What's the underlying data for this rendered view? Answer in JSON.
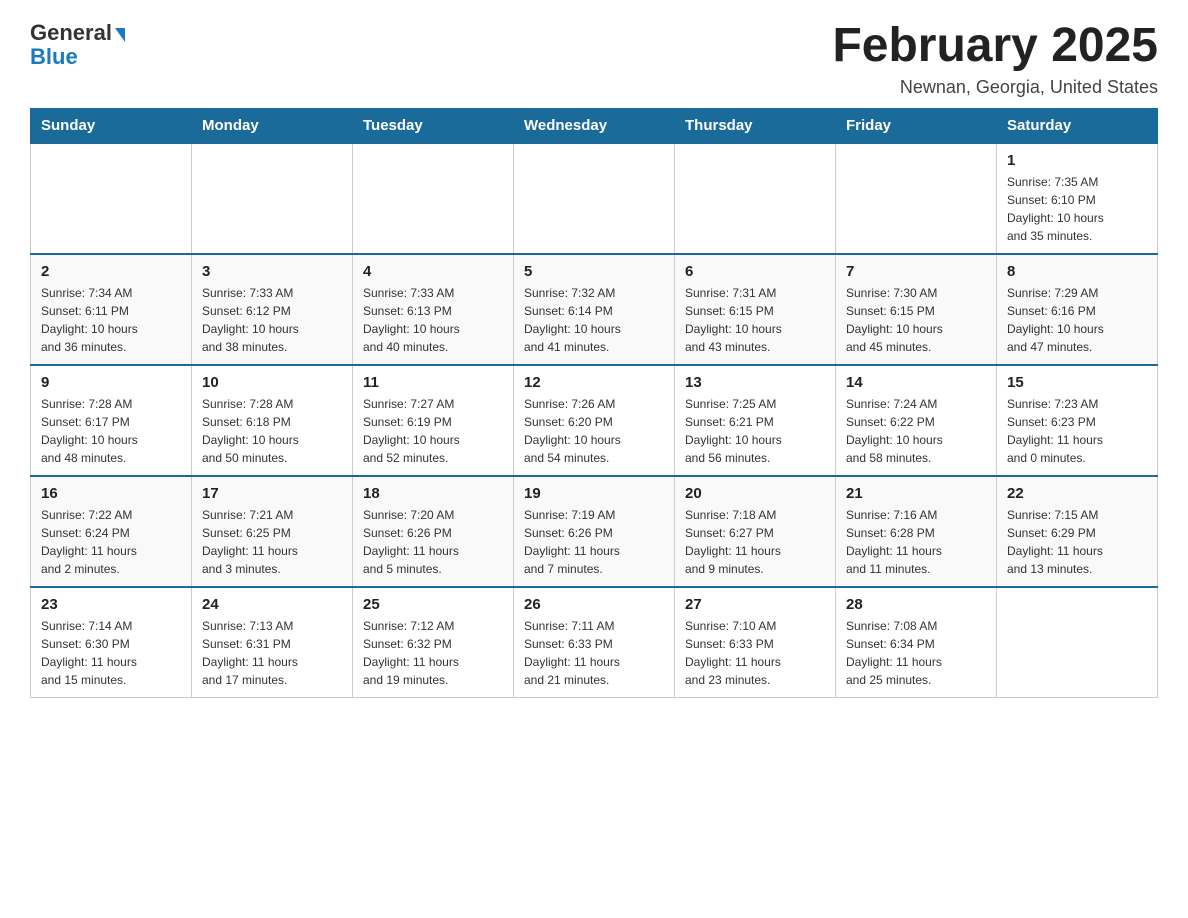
{
  "logo": {
    "general": "General",
    "blue": "Blue"
  },
  "header": {
    "title": "February 2025",
    "location": "Newnan, Georgia, United States"
  },
  "weekdays": [
    "Sunday",
    "Monday",
    "Tuesday",
    "Wednesday",
    "Thursday",
    "Friday",
    "Saturday"
  ],
  "weeks": [
    [
      {
        "day": "",
        "info": ""
      },
      {
        "day": "",
        "info": ""
      },
      {
        "day": "",
        "info": ""
      },
      {
        "day": "",
        "info": ""
      },
      {
        "day": "",
        "info": ""
      },
      {
        "day": "",
        "info": ""
      },
      {
        "day": "1",
        "info": "Sunrise: 7:35 AM\nSunset: 6:10 PM\nDaylight: 10 hours\nand 35 minutes."
      }
    ],
    [
      {
        "day": "2",
        "info": "Sunrise: 7:34 AM\nSunset: 6:11 PM\nDaylight: 10 hours\nand 36 minutes."
      },
      {
        "day": "3",
        "info": "Sunrise: 7:33 AM\nSunset: 6:12 PM\nDaylight: 10 hours\nand 38 minutes."
      },
      {
        "day": "4",
        "info": "Sunrise: 7:33 AM\nSunset: 6:13 PM\nDaylight: 10 hours\nand 40 minutes."
      },
      {
        "day": "5",
        "info": "Sunrise: 7:32 AM\nSunset: 6:14 PM\nDaylight: 10 hours\nand 41 minutes."
      },
      {
        "day": "6",
        "info": "Sunrise: 7:31 AM\nSunset: 6:15 PM\nDaylight: 10 hours\nand 43 minutes."
      },
      {
        "day": "7",
        "info": "Sunrise: 7:30 AM\nSunset: 6:15 PM\nDaylight: 10 hours\nand 45 minutes."
      },
      {
        "day": "8",
        "info": "Sunrise: 7:29 AM\nSunset: 6:16 PM\nDaylight: 10 hours\nand 47 minutes."
      }
    ],
    [
      {
        "day": "9",
        "info": "Sunrise: 7:28 AM\nSunset: 6:17 PM\nDaylight: 10 hours\nand 48 minutes."
      },
      {
        "day": "10",
        "info": "Sunrise: 7:28 AM\nSunset: 6:18 PM\nDaylight: 10 hours\nand 50 minutes."
      },
      {
        "day": "11",
        "info": "Sunrise: 7:27 AM\nSunset: 6:19 PM\nDaylight: 10 hours\nand 52 minutes."
      },
      {
        "day": "12",
        "info": "Sunrise: 7:26 AM\nSunset: 6:20 PM\nDaylight: 10 hours\nand 54 minutes."
      },
      {
        "day": "13",
        "info": "Sunrise: 7:25 AM\nSunset: 6:21 PM\nDaylight: 10 hours\nand 56 minutes."
      },
      {
        "day": "14",
        "info": "Sunrise: 7:24 AM\nSunset: 6:22 PM\nDaylight: 10 hours\nand 58 minutes."
      },
      {
        "day": "15",
        "info": "Sunrise: 7:23 AM\nSunset: 6:23 PM\nDaylight: 11 hours\nand 0 minutes."
      }
    ],
    [
      {
        "day": "16",
        "info": "Sunrise: 7:22 AM\nSunset: 6:24 PM\nDaylight: 11 hours\nand 2 minutes."
      },
      {
        "day": "17",
        "info": "Sunrise: 7:21 AM\nSunset: 6:25 PM\nDaylight: 11 hours\nand 3 minutes."
      },
      {
        "day": "18",
        "info": "Sunrise: 7:20 AM\nSunset: 6:26 PM\nDaylight: 11 hours\nand 5 minutes."
      },
      {
        "day": "19",
        "info": "Sunrise: 7:19 AM\nSunset: 6:26 PM\nDaylight: 11 hours\nand 7 minutes."
      },
      {
        "day": "20",
        "info": "Sunrise: 7:18 AM\nSunset: 6:27 PM\nDaylight: 11 hours\nand 9 minutes."
      },
      {
        "day": "21",
        "info": "Sunrise: 7:16 AM\nSunset: 6:28 PM\nDaylight: 11 hours\nand 11 minutes."
      },
      {
        "day": "22",
        "info": "Sunrise: 7:15 AM\nSunset: 6:29 PM\nDaylight: 11 hours\nand 13 minutes."
      }
    ],
    [
      {
        "day": "23",
        "info": "Sunrise: 7:14 AM\nSunset: 6:30 PM\nDaylight: 11 hours\nand 15 minutes."
      },
      {
        "day": "24",
        "info": "Sunrise: 7:13 AM\nSunset: 6:31 PM\nDaylight: 11 hours\nand 17 minutes."
      },
      {
        "day": "25",
        "info": "Sunrise: 7:12 AM\nSunset: 6:32 PM\nDaylight: 11 hours\nand 19 minutes."
      },
      {
        "day": "26",
        "info": "Sunrise: 7:11 AM\nSunset: 6:33 PM\nDaylight: 11 hours\nand 21 minutes."
      },
      {
        "day": "27",
        "info": "Sunrise: 7:10 AM\nSunset: 6:33 PM\nDaylight: 11 hours\nand 23 minutes."
      },
      {
        "day": "28",
        "info": "Sunrise: 7:08 AM\nSunset: 6:34 PM\nDaylight: 11 hours\nand 25 minutes."
      },
      {
        "day": "",
        "info": ""
      }
    ]
  ]
}
